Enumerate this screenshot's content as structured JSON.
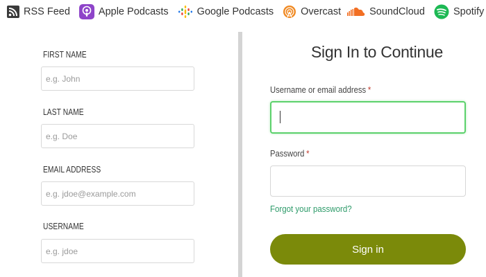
{
  "podcasts": [
    {
      "label": "RSS Feed",
      "icon": "rss-icon"
    },
    {
      "label": "Apple Podcasts",
      "icon": "apple-podcasts-icon"
    },
    {
      "label": "Google Podcasts",
      "icon": "google-podcasts-icon"
    },
    {
      "label": "Overcast",
      "icon": "overcast-icon"
    },
    {
      "label": "SoundCloud",
      "icon": "soundcloud-icon"
    },
    {
      "label": "Spotify",
      "icon": "spotify-icon"
    }
  ],
  "register": {
    "first_name": {
      "label": "FIRST NAME",
      "placeholder": "e.g. John"
    },
    "last_name": {
      "label": "LAST NAME",
      "placeholder": "e.g. Doe"
    },
    "email": {
      "label": "EMAIL ADDRESS",
      "placeholder": "e.g. jdoe@example.com"
    },
    "username": {
      "label": "USERNAME",
      "placeholder": "e.g. jdoe"
    }
  },
  "signin": {
    "title": "Sign In to Continue",
    "username_label": "Username or email address",
    "password_label": "Password",
    "required_mark": "*",
    "forgot_link": "Forgot your password?",
    "button": "Sign in"
  },
  "colors": {
    "accent_button": "#7b8a0a",
    "focus_border": "#5bd16b",
    "link": "#2e9b6a",
    "required": "#c0392b",
    "apple_podcasts": "#8e44c9",
    "soundcloud": "#f26f23",
    "spotify": "#1db954",
    "overcast": "#f08a24"
  }
}
